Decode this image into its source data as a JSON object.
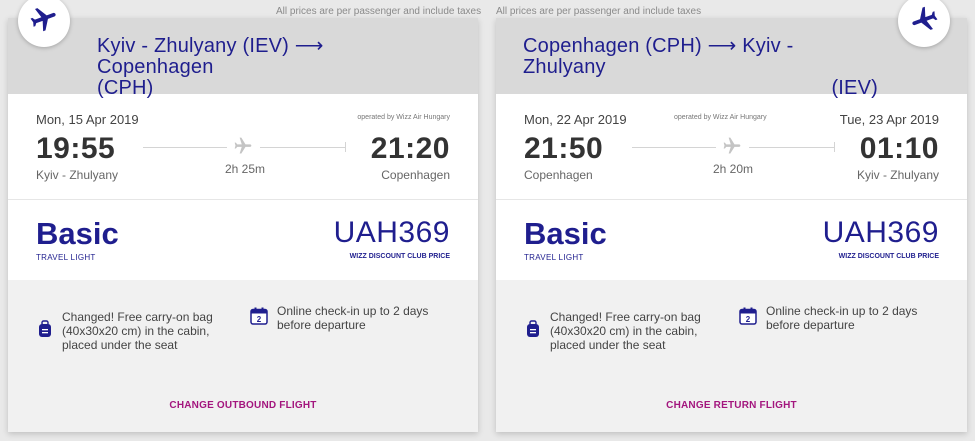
{
  "note": "All prices are per passenger and include taxes",
  "colors": {
    "brand": "#1f1e8e",
    "accent": "#a3167e",
    "header_bg": "#d9d9d9",
    "perk_bg": "#f1f1f1"
  },
  "outbound": {
    "route_line1": "Kyiv - Zhulyany (IEV) ⟶ Copenhagen",
    "route_line2": "(CPH)",
    "departure_date": "Mon, 15 Apr 2019",
    "operated_by": "operated by Wizz Air Hungary",
    "departure_time": "19:55",
    "arrival_time": "21:20",
    "departure_city": "Kyiv - Zhulyany",
    "arrival_city": "Copenhagen",
    "duration": "2h 25m",
    "fare_name": "Basic",
    "fare_sub": "TRAVEL LIGHT",
    "price": "UAH369",
    "price_note": "WIZZ DISCOUNT CLUB PRICE",
    "perk_bag": [
      "Changed! Free carry-on bag",
      "(40x30x20 cm) in the cabin,",
      "placed under the seat"
    ],
    "perk_checkin": [
      "Online check-in up to 2 days",
      "before departure"
    ],
    "calendar_day": "2",
    "change_label": "CHANGE OUTBOUND FLIGHT"
  },
  "return": {
    "route_line1": "Copenhagen (CPH) ⟶ Kyiv - Zhulyany",
    "route_line2": "(IEV)",
    "departure_date": "Mon, 22 Apr 2019",
    "arrival_date": "Tue, 23 Apr 2019",
    "operated_by": "operated by Wizz Air Hungary",
    "departure_time": "21:50",
    "arrival_time": "01:10",
    "departure_city": "Copenhagen",
    "arrival_city": "Kyiv - Zhulyany",
    "duration": "2h 20m",
    "fare_name": "Basic",
    "fare_sub": "TRAVEL LIGHT",
    "price": "UAH369",
    "price_note": "WIZZ DISCOUNT CLUB PRICE",
    "perk_bag": [
      "Changed! Free carry-on bag",
      "(40x30x20 cm) in the cabin,",
      "placed under the seat"
    ],
    "perk_checkin": [
      "Online check-in up to 2 days",
      "before departure"
    ],
    "calendar_day": "2",
    "change_label": "CHANGE RETURN FLIGHT"
  }
}
